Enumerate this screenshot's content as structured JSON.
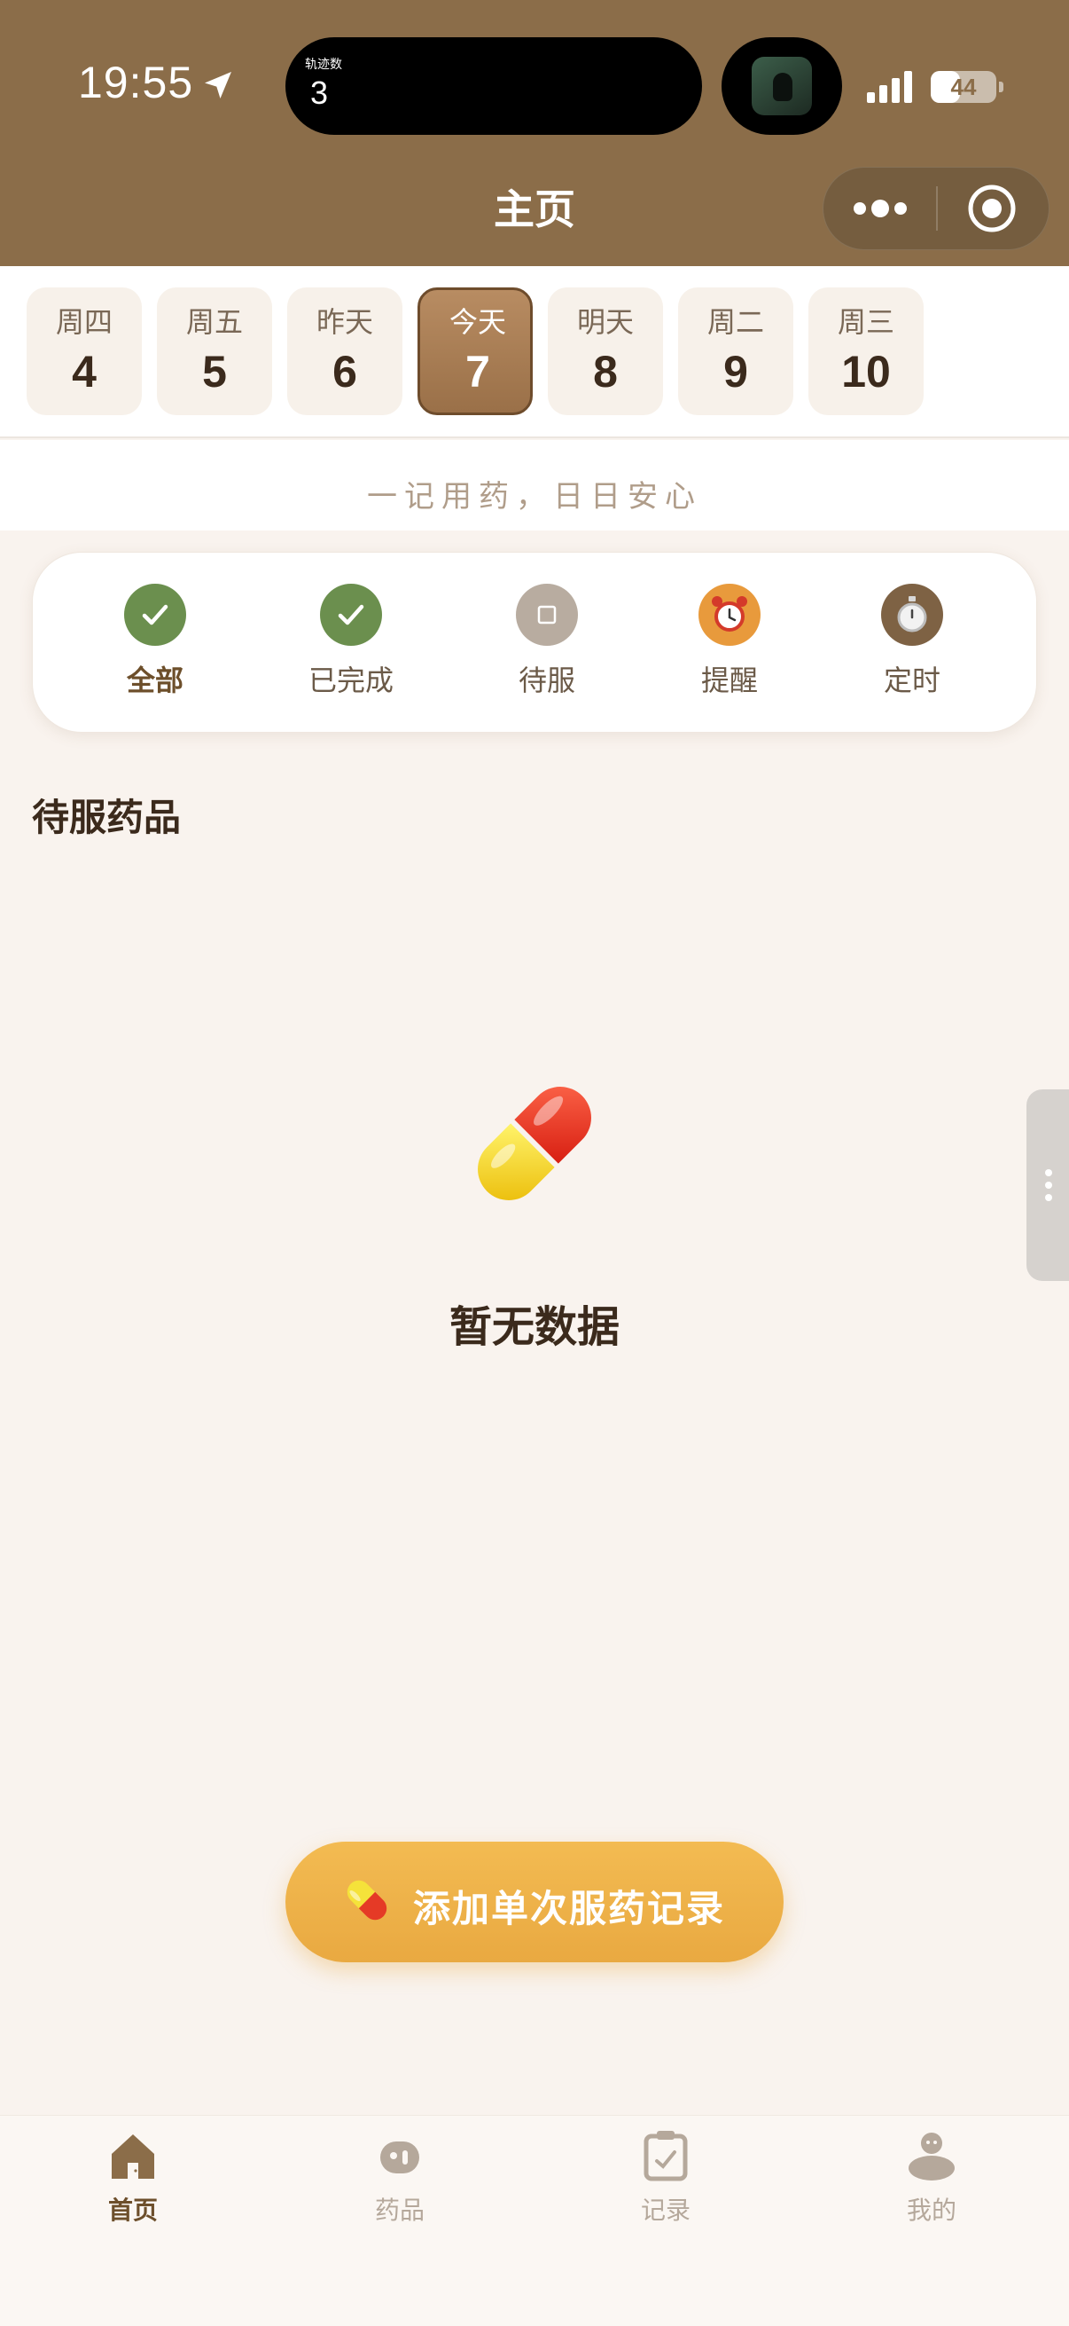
{
  "status_bar": {
    "time": "19:55",
    "island_label": "轨迹数",
    "island_count": "3",
    "battery_level": 0.44,
    "battery_text": "44",
    "icons": [
      "location-arrow-icon",
      "cellular-signal-icon",
      "battery-icon"
    ]
  },
  "nav": {
    "title": "主页",
    "capsule_icons": [
      "more-dots-icon",
      "target-circle-icon"
    ]
  },
  "dates": [
    {
      "weekday": "周四",
      "day": "4",
      "active": false
    },
    {
      "weekday": "周五",
      "day": "5",
      "active": false
    },
    {
      "weekday": "昨天",
      "day": "6",
      "active": false
    },
    {
      "weekday": "今天",
      "day": "7",
      "active": true
    },
    {
      "weekday": "明天",
      "day": "8",
      "active": false
    },
    {
      "weekday": "周二",
      "day": "9",
      "active": false
    },
    {
      "weekday": "周三",
      "day": "10",
      "active": false
    }
  ],
  "slogan": "一记用药，日日安心",
  "filters": [
    {
      "label": "全部",
      "icon": "check-circle-icon",
      "color": "#6b8f4e",
      "active": true
    },
    {
      "label": "已完成",
      "icon": "check-circle-icon",
      "color": "#6b8f4e",
      "active": false
    },
    {
      "label": "待服",
      "icon": "square-circle-icon",
      "color": "#b8aca0",
      "active": false
    },
    {
      "label": "提醒",
      "icon": "alarm-clock-icon",
      "color": "#e89a3c",
      "active": false
    },
    {
      "label": "定时",
      "icon": "stopwatch-icon",
      "color": "#7e6244",
      "active": false
    }
  ],
  "section": {
    "title": "待服药品",
    "empty_icon": "pill-capsule-icon",
    "empty_text": "暂无数据"
  },
  "add_button": {
    "icon": "pill-capsule-icon",
    "label": "添加单次服药记录"
  },
  "tabs": [
    {
      "label": "首页",
      "icon": "home-icon",
      "active": true
    },
    {
      "label": "药品",
      "icon": "medicine-icon",
      "active": false
    },
    {
      "label": "记录",
      "icon": "clipboard-icon",
      "active": false
    },
    {
      "label": "我的",
      "icon": "profile-icon",
      "active": false
    }
  ],
  "colors": {
    "brand_brown": "#8b6d49",
    "accent_orange": "#f0b44c",
    "background": "#f9f3ee",
    "success_green": "#6b8f4e"
  }
}
